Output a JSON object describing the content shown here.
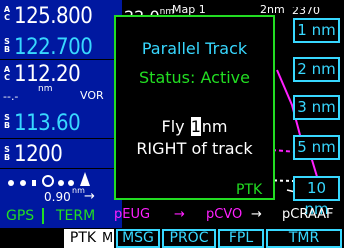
{
  "left_panel": {
    "com_active_label": "A\nC",
    "com_active": "125.800",
    "com_standby_label": "S\nB",
    "com_standby": "122.700",
    "nav_active_label": "A\nC",
    "nav_active": "112.20",
    "nav_dist_label": "--.-",
    "nav_dist_unit": "nm",
    "nav_source": "VOR",
    "nav_standby_label": "S\nB",
    "nav_standby": "113.60",
    "xpdr_label": "S\nB",
    "xpdr_code": "1200",
    "cdi_distance": "0.90",
    "cdi_unit": "nm",
    "gps_mode": "GPS",
    "gps_phase": "TERM"
  },
  "map": {
    "range": "22.0",
    "range_unit": "nm",
    "title": "Map 1",
    "scale": "2nm",
    "heading_partial": "2370",
    "ptk_label": "PTK"
  },
  "popup": {
    "title": "Parallel Track",
    "status": "Status:  Active",
    "fly_prefix": "Fly",
    "fly_value": "1",
    "fly_unit": "nm",
    "direction_line": "RIGHT of track"
  },
  "offset_buttons": [
    "1 nm",
    "2 nm",
    "3 nm",
    "5 nm",
    "10 nm"
  ],
  "route": {
    "from": "pEUG",
    "mid": "pCVO",
    "to": "pCRAAF"
  },
  "softkeys": {
    "ptk": "PTK",
    "m": "M",
    "msg": "MSG",
    "proc": "PROC",
    "fpl": "FPL",
    "tmr": "TMR"
  },
  "colors": {
    "cyan": "#38d8ff",
    "green": "#22dd22",
    "magenta": "#ff20ff",
    "panel_blue": "#0018a0"
  }
}
